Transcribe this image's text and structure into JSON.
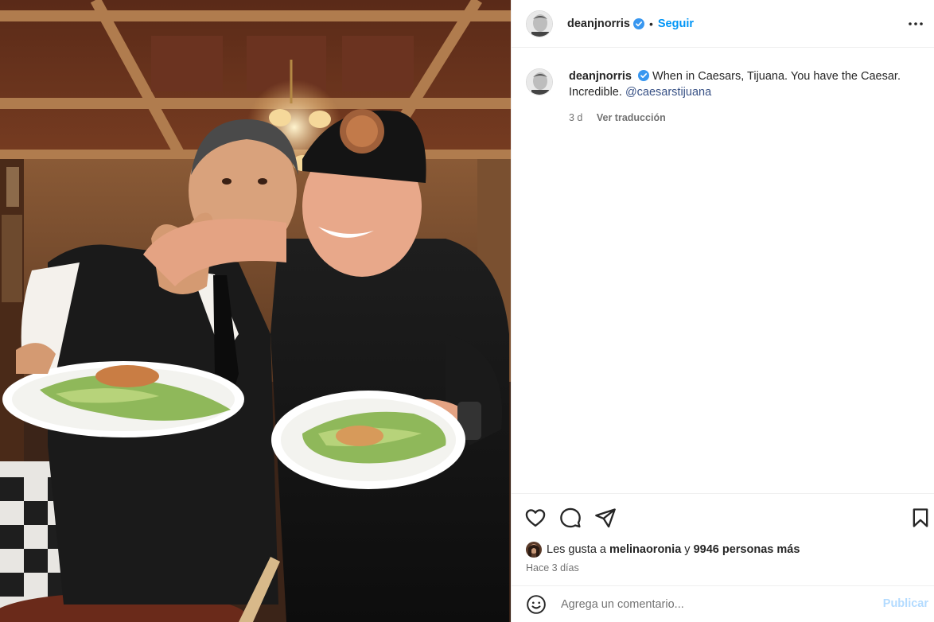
{
  "post": {
    "username": "deanjnorris",
    "follow_label": "Seguir",
    "separator": "•",
    "caption_text": "When in Caesars, Tijuana. You have the Caesar. Incredible.",
    "caption_mention": "@caesarstijuana",
    "caption_age": "3 d",
    "translate_label": "Ver traducción",
    "likes_prefix": "Les gusta a",
    "likes_user": "melinaoronia",
    "likes_conjunction": "y",
    "likes_others": "9946 personas más",
    "posted_time": "Hace 3 días",
    "comment_placeholder": "Agrega un comentario...",
    "publish_label": "Publicar"
  },
  "icons": {
    "verified": "verified-badge-icon",
    "more": "more-options-icon",
    "like": "heart-icon",
    "comment": "comment-bubble-icon",
    "share": "paper-plane-icon",
    "save": "bookmark-icon",
    "emoji": "emoji-smile-icon"
  },
  "colors": {
    "link_blue": "#0095f6",
    "mention_blue": "#385185",
    "verified_blue": "#3897f0",
    "muted_text": "#737373",
    "publish_disabled": "#b3dbff"
  }
}
